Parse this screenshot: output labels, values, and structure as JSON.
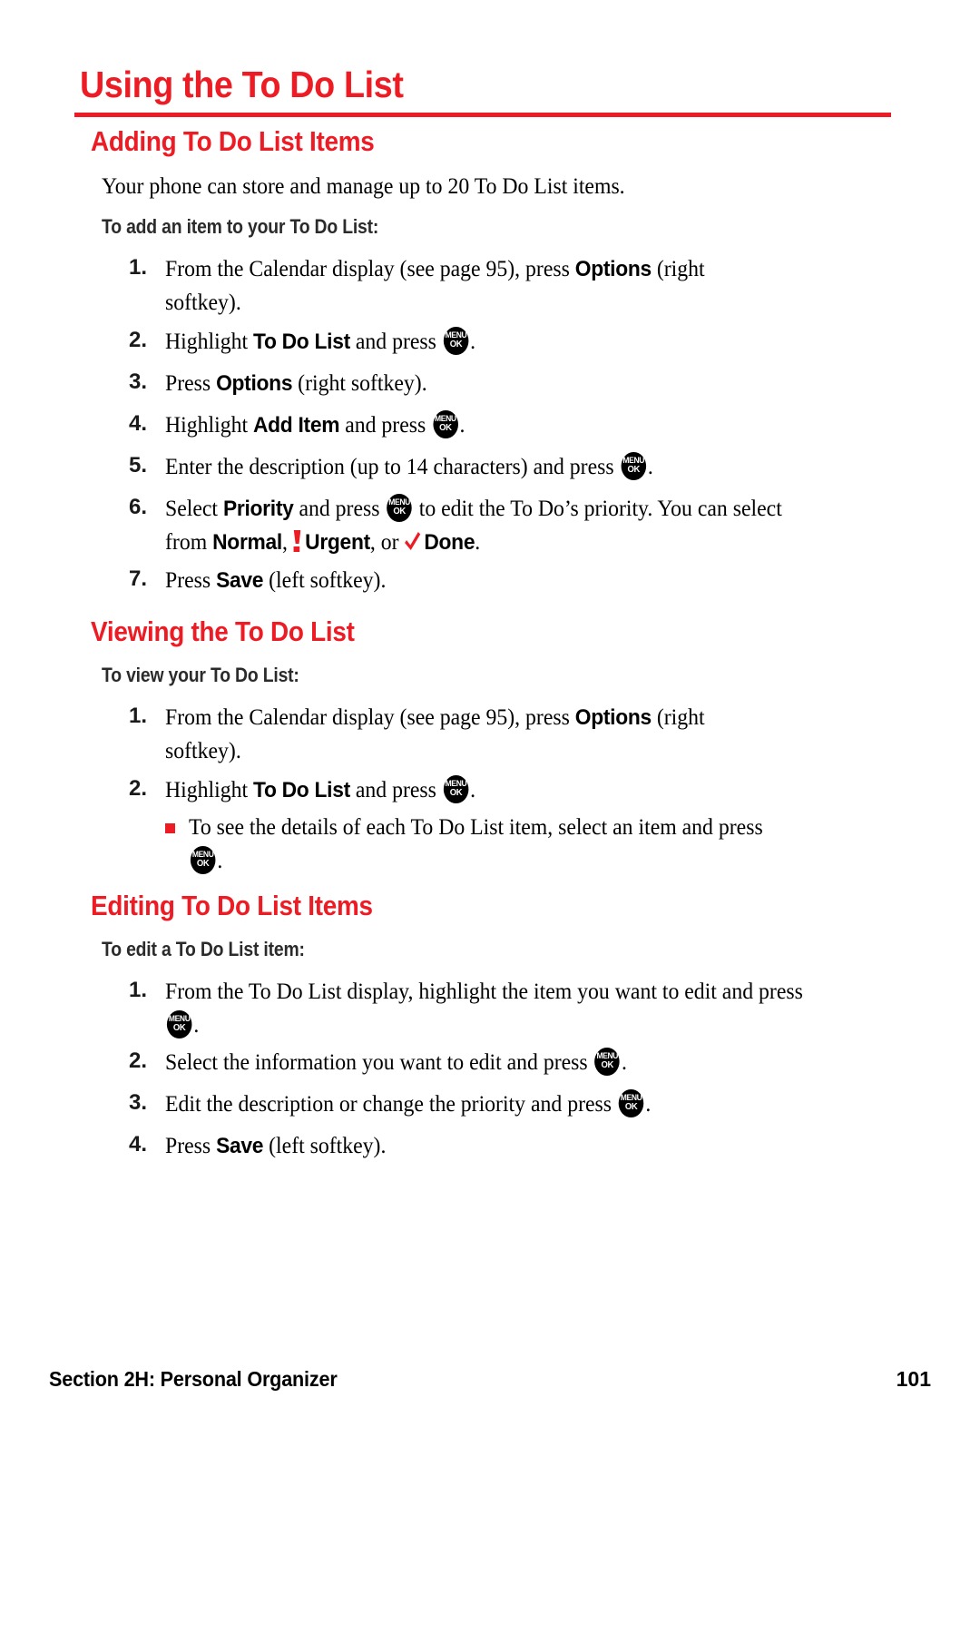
{
  "page": {
    "chapter_title": "Using the To Do List",
    "accent_color": "#ed1c24",
    "text_color": "#000000",
    "subheading_color": "#2b2b2b"
  },
  "icons": {
    "menu_label": "MENU",
    "ok_label": "OK",
    "urgent_name": "urgent-exclamation-icon",
    "done_name": "done-check-icon",
    "bullet_name": "square-bullet-icon"
  },
  "sections": {
    "adding": {
      "heading": "Adding To Do List Items",
      "intro": "Your phone can store and manage up to 20 To Do List items.",
      "subheading": "To add an item to your To Do List:",
      "steps": [
        {
          "num": "1.",
          "pre": "From the Calendar display (see page 95), press ",
          "kw1": "Options",
          "post": " (right softkey)."
        },
        {
          "num": "2.",
          "pre": "Highlight ",
          "kw1": "To Do List",
          "mid": " and press ",
          "post": "."
        },
        {
          "num": "3.",
          "pre": "Press ",
          "kw1": "Options",
          "post": " (right softkey)."
        },
        {
          "num": "4.",
          "pre": "Highlight ",
          "kw1": "Add Item",
          "mid": " and press ",
          "post": "."
        },
        {
          "num": "5.",
          "pre": "Enter the description (up to 14 characters) and press ",
          "post": "."
        },
        {
          "num": "6.",
          "pre": "Select ",
          "kw1": "Priority",
          "mid": " and press ",
          "mid2": " to edit the To Do’s priority. You can select from ",
          "kw_normal": "Normal",
          "sep1": ", ",
          "kw_urgent": "Urgent",
          "sep2": ", or ",
          "kw_done": "Done",
          "post": "."
        },
        {
          "num": "7.",
          "pre": "Press ",
          "kw1": "Save",
          "post": " (left softkey)."
        }
      ]
    },
    "viewing": {
      "heading": "Viewing the To Do List",
      "subheading": "To view your To Do List:",
      "steps": [
        {
          "num": "1.",
          "pre": "From the Calendar display (see page 95), press ",
          "kw1": "Options",
          "post": " (right softkey)."
        },
        {
          "num": "2.",
          "pre": "Highlight ",
          "kw1": "To Do List",
          "mid": " and press ",
          "post": "."
        }
      ],
      "bullet": {
        "pre": "To see the details of each To Do List item, select an item and press ",
        "post": "."
      }
    },
    "editing": {
      "heading": "Editing To Do List Items",
      "subheading": "To edit a To Do List item:",
      "steps": [
        {
          "num": "1.",
          "pre": "From the To Do List display, highlight the item you want to edit and press ",
          "post": "."
        },
        {
          "num": "2.",
          "pre": "Select the information you want to edit and press ",
          "post": "."
        },
        {
          "num": "3.",
          "pre": "Edit the description or change the priority and press ",
          "post": "."
        },
        {
          "num": "4.",
          "pre": "Press ",
          "kw1": "Save",
          "post": " (left softkey)."
        }
      ]
    }
  },
  "footer": {
    "section_label": "Section 2H: Personal Organizer",
    "page_number": "101"
  }
}
